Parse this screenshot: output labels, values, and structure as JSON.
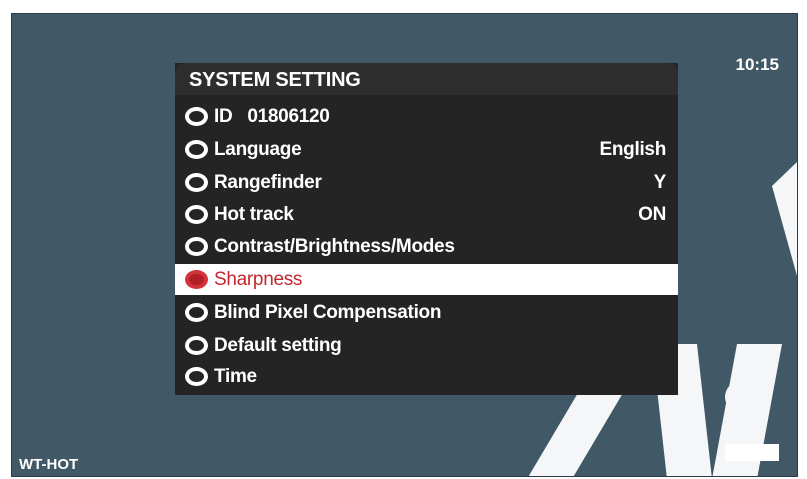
{
  "status": {
    "time": "10:15",
    "model": "WT-HOT"
  },
  "menu": {
    "title": "SYSTEM SETTING",
    "items": [
      {
        "label": "ID  01806120",
        "value": ""
      },
      {
        "label": "Language",
        "value": "English"
      },
      {
        "label": "Rangefinder",
        "value": "Y"
      },
      {
        "label": "Hot track",
        "value": "ON"
      },
      {
        "label": "Contrast/Brightness/Modes",
        "value": ""
      },
      {
        "label": "Sharpness",
        "value": "",
        "selected": true
      },
      {
        "label": "Blind Pixel Compensation",
        "value": ""
      },
      {
        "label": "Default setting",
        "value": ""
      },
      {
        "label": "Time",
        "value": ""
      }
    ]
  },
  "colors": {
    "screen_bg": "#415867",
    "menu_bg": "#242424",
    "selected_text": "#c4272f",
    "selected_bg": "#ffffff"
  },
  "icons": {
    "item_marker": "radio-ring-icon",
    "battery": "battery-icon"
  }
}
